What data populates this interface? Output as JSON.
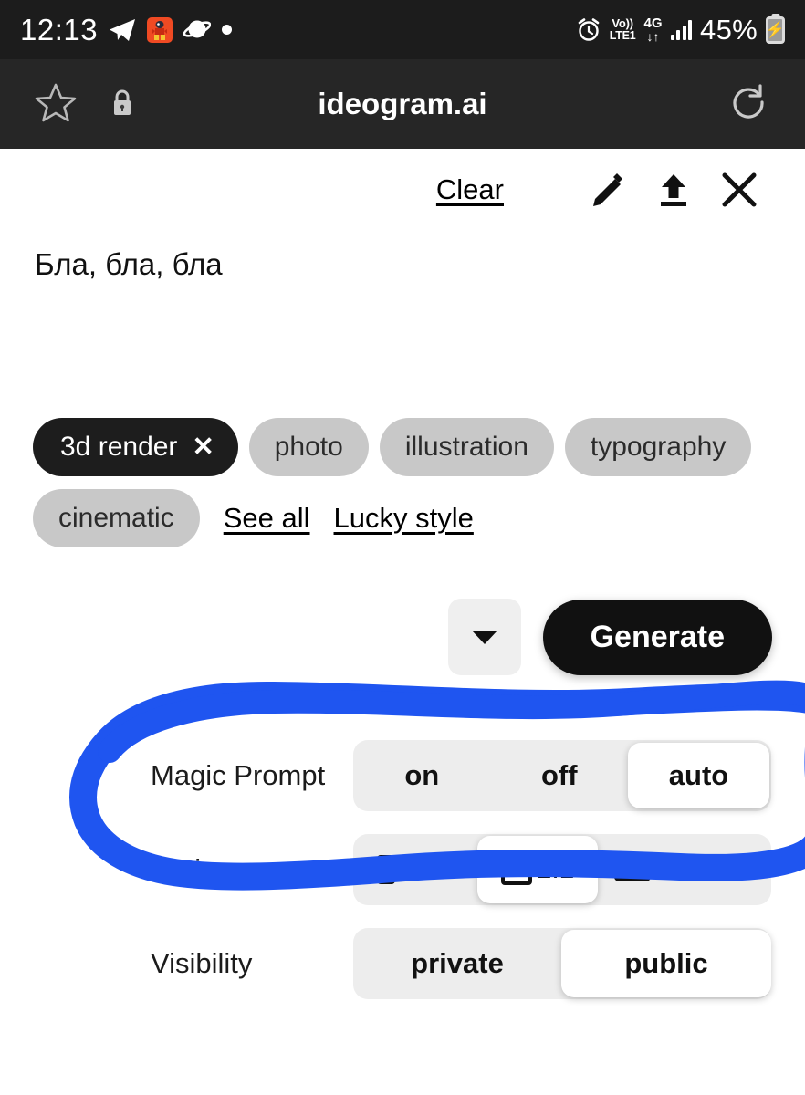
{
  "status_bar": {
    "time": "12:13",
    "battery_percent": "45%",
    "network_type": "4G",
    "volte_line1": "Vo))",
    "volte_line2": "LTE1",
    "icons": [
      "telegram-icon",
      "app-badge-icon",
      "planet-icon",
      "dot-icon",
      "alarm-icon",
      "volte-icon",
      "signal-bars-icon",
      "battery-charging-icon"
    ]
  },
  "browser_bar": {
    "title": "ideogram.ai",
    "icons": [
      "star-icon",
      "lock-icon",
      "reload-icon"
    ]
  },
  "toolbar": {
    "clear_label": "Clear",
    "icons": [
      "edit-pencil-icon",
      "upload-icon",
      "close-icon"
    ]
  },
  "prompt": {
    "text": "Бла, бла, бла"
  },
  "style_chips": {
    "row1": [
      {
        "label": "3d render",
        "selected": true,
        "remove": "✕"
      },
      {
        "label": "photo",
        "selected": false
      },
      {
        "label": "illustration",
        "selected": false
      },
      {
        "label": "typography",
        "selected": false
      }
    ],
    "row2": [
      {
        "label": "cinematic",
        "selected": false
      }
    ],
    "links": [
      {
        "label": "See all"
      },
      {
        "label": "Lucky style"
      }
    ]
  },
  "generate": {
    "button_label": "Generate",
    "caret_icon": "chevron-down-icon"
  },
  "settings": {
    "magic_prompt": {
      "label": "Magic Prompt",
      "options": [
        "on",
        "off",
        "auto"
      ],
      "selected": "auto"
    },
    "ratio": {
      "label": "Ratio",
      "options": [
        "9:16",
        "1:1",
        "16:9"
      ],
      "selected": "1:1",
      "more_icon": "chevron-down-icon"
    },
    "visibility": {
      "label": "Visibility",
      "options": [
        "private",
        "public"
      ],
      "selected": "public"
    }
  },
  "annotation": {
    "type": "hand-drawn-ellipse",
    "color": "#1f55f0",
    "target": "magic-prompt-row"
  },
  "colors": {
    "status_bar_bg": "#1c1c1c",
    "browser_bar_bg": "#262626",
    "page_bg": "#ffffff",
    "chip_bg": "#c8c8c8",
    "chip_selected_bg": "#1d1d1d",
    "segment_bg": "#ededed",
    "accent_blue": "#1f55f0",
    "button_dark": "#111111"
  }
}
